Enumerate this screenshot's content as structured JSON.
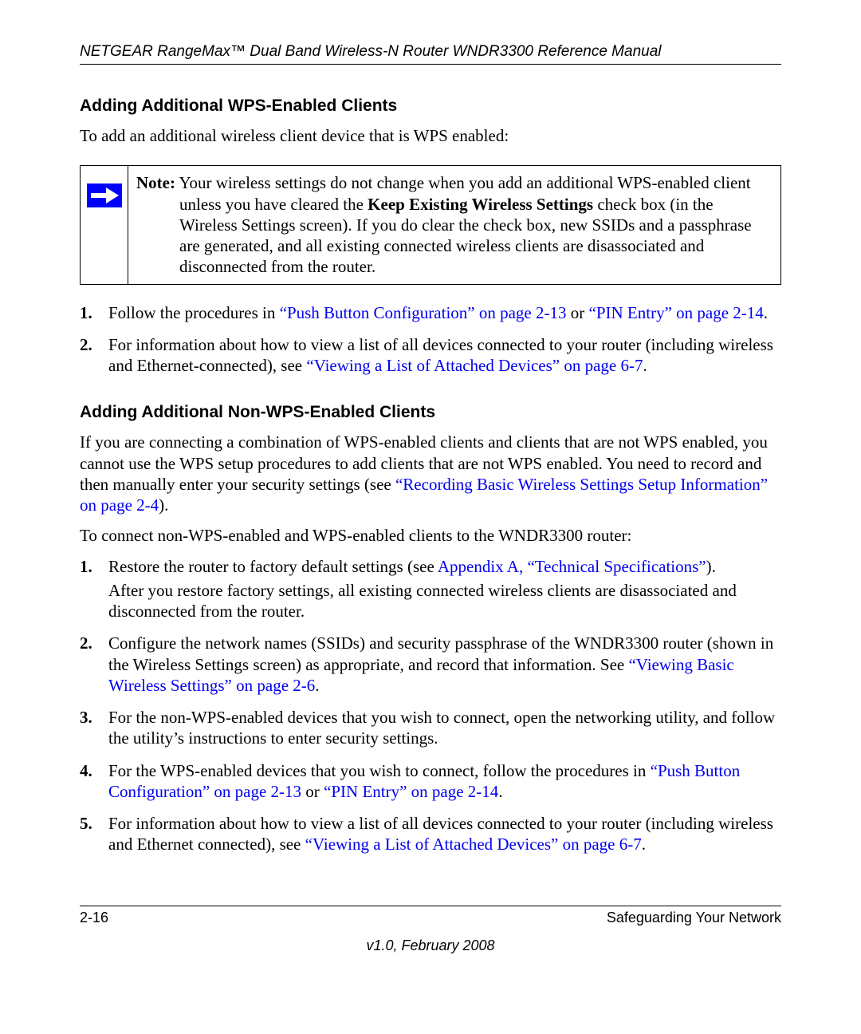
{
  "header": {
    "running_title": "NETGEAR RangeMax™ Dual Band Wireless-N Router WNDR3300 Reference Manual"
  },
  "section1": {
    "heading": "Adding Additional WPS-Enabled Clients",
    "intro": "To add an additional wireless client device that is WPS enabled:",
    "note": {
      "label": "Note:",
      "body_pre": " Your wireless settings do not change when you add an additional WPS-enabled client unless you have cleared the ",
      "body_bold": "Keep Existing Wireless Settings",
      "body_post": " check box (in the Wireless Settings screen). If you do clear the check box, new SSIDs and a passphrase are generated, and all existing connected wireless clients are disassociated and disconnected from the router."
    },
    "steps": [
      {
        "pre": "Follow the procedures in ",
        "link1": "“Push Button Configuration” on page 2-13",
        "mid": " or ",
        "link2": "“PIN Entry” on page 2-14",
        "post": "."
      },
      {
        "pre": "For information about how to view a list of all devices connected to your router (including wireless and Ethernet-connected), see ",
        "link1": "“Viewing a List of Attached Devices” on page 6-7",
        "post": "."
      }
    ]
  },
  "section2": {
    "heading": "Adding Additional Non-WPS-Enabled Clients",
    "intro_pre": "If you are connecting a combination of WPS-enabled clients and clients that are not WPS enabled, you cannot use the WPS setup procedures to add clients that are not WPS enabled. You need to record and then manually enter your security settings (see ",
    "intro_link": "“Recording Basic Wireless Settings Setup Information” on page 2-4",
    "intro_post": ").",
    "para2": "To connect non-WPS-enabled and WPS-enabled clients to the WNDR3300 router:",
    "steps": [
      {
        "pre": "Restore the router to factory default settings (see ",
        "link1": "Appendix A, “Technical Specifications”",
        "post": ").",
        "sub": "After you restore factory settings, all existing connected wireless clients are disassociated and disconnected from the router."
      },
      {
        "pre": "Configure the network names (SSIDs) and security passphrase of the WNDR3300 router (shown in the Wireless Settings screen) as appropriate, and record that information. See ",
        "link1": "“Viewing Basic Wireless Settings” on page 2-6",
        "post": "."
      },
      {
        "text": "For the non-WPS-enabled devices that you wish to connect, open the networking utility, and follow the utility’s instructions to enter security settings."
      },
      {
        "pre": "For the WPS-enabled devices that you wish to connect, follow the procedures in ",
        "link1": "“Push Button Configuration” on page 2-13",
        "mid": " or ",
        "link2": "“PIN Entry” on page 2-14",
        "post": "."
      },
      {
        "pre": "For information about how to view a list of all devices connected to your router (including wireless and Ethernet connected), see ",
        "link1": "“Viewing a List of Attached Devices” on page 6-7",
        "post": "."
      }
    ]
  },
  "footer": {
    "left": "2-16",
    "right": "Safeguarding Your Network",
    "version": "v1.0, February 2008"
  }
}
